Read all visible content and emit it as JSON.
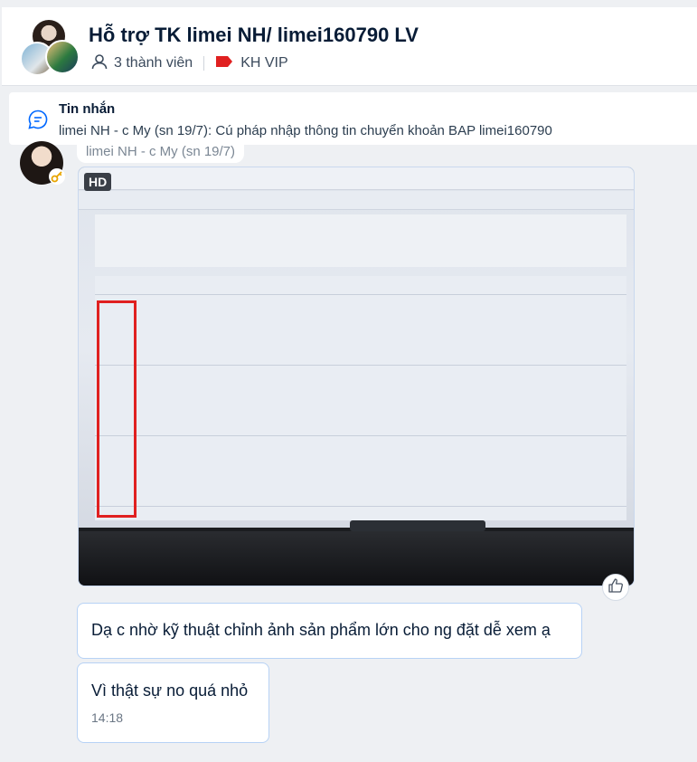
{
  "header": {
    "title": "Hỗ trợ TK limei NH/ limei160790 LV",
    "members": "3 thành viên",
    "label_tag": "KH VIP",
    "colors": {
      "tag": "#e02020",
      "bubble_border": "#b7d2f5"
    }
  },
  "pinned": {
    "icon": "message-circle-icon",
    "title": "Tin nhắn",
    "text": "limei NH - c My (sn 19/7): Cú pháp nhập thông tin chuyển khoản BAP limei160790"
  },
  "message_group": {
    "sender": "limei NH - c My (sn 19/7)",
    "image_badge": "HD",
    "messages": [
      {
        "text": "Dạ c nhờ kỹ thuật chỉnh ảnh sản phẩm lớn cho ng đặt dễ xem ạ"
      },
      {
        "text": "Vì thật sự no quá nhỏ",
        "time": "14:18"
      }
    ]
  }
}
